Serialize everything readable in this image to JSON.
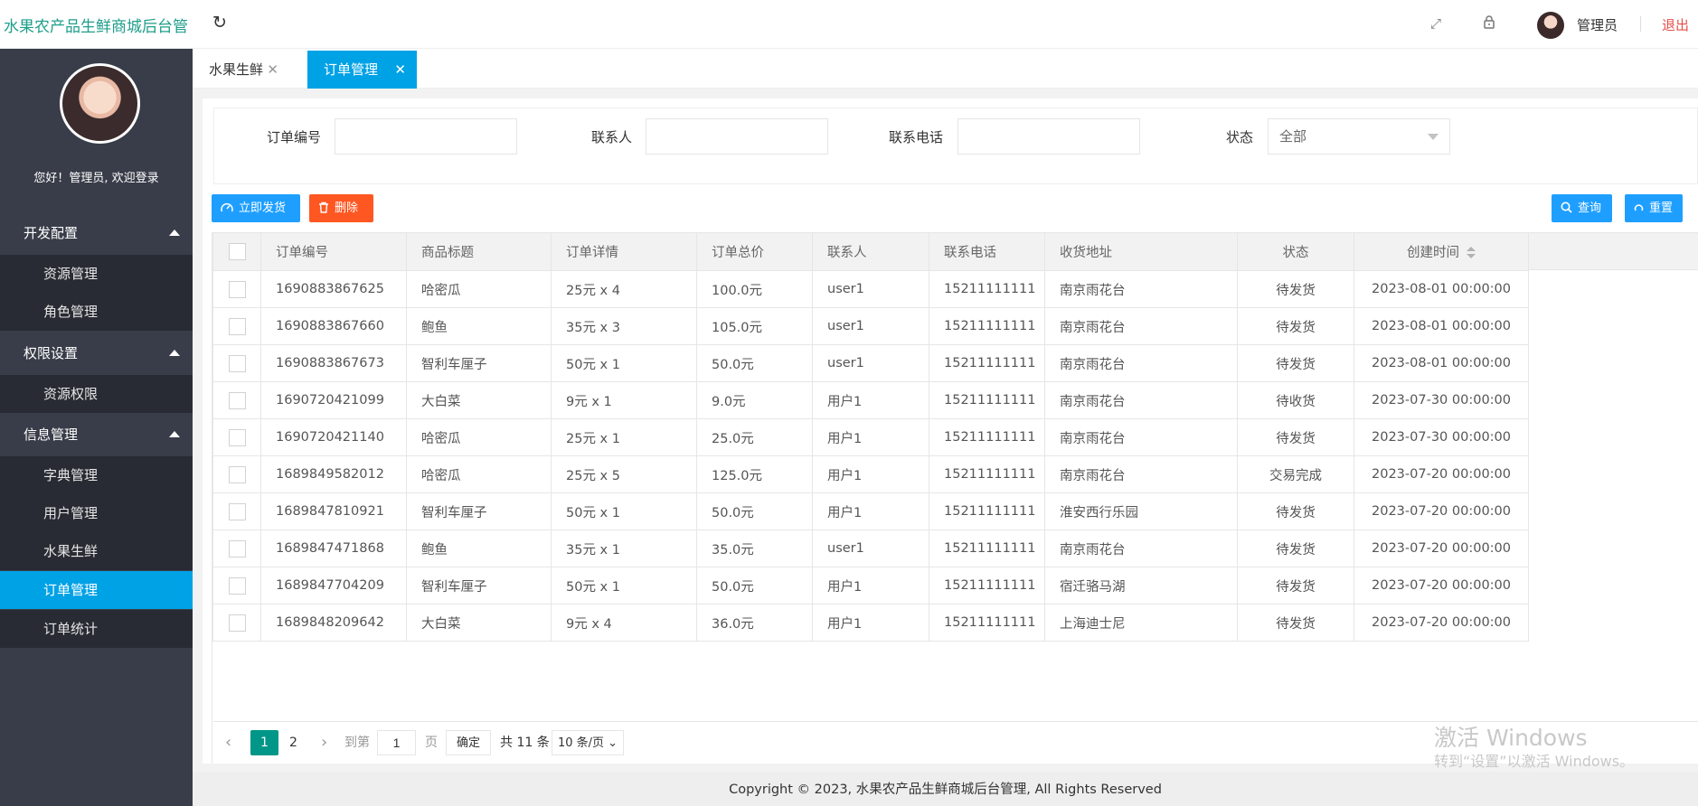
{
  "header": {
    "app_title": "水果农产品生鲜商城后台管",
    "admin_name": "管理员",
    "logout": "退出",
    "icons": [
      "refresh-icon",
      "fullscreen-icon",
      "lock-icon"
    ]
  },
  "sidebar": {
    "welcome": "您好！管理员, 欢迎登录",
    "groups": [
      {
        "label": "开发配置",
        "items": [
          "资源管理",
          "角色管理"
        ]
      },
      {
        "label": "权限设置",
        "items": [
          "资源权限"
        ]
      },
      {
        "label": "信息管理",
        "items": [
          "字典管理",
          "用户管理",
          "水果生鲜",
          "订单管理",
          "订单统计"
        ]
      }
    ],
    "active_item": "订单管理",
    "colors": {
      "bg": "#393d49",
      "submenu_bg": "#282b33",
      "active": "#00a2e6"
    }
  },
  "tabs": [
    {
      "label": "水果生鲜",
      "active": false
    },
    {
      "label": "订单管理",
      "active": true
    }
  ],
  "search": {
    "order_no_label": "订单编号",
    "contact_label": "联系人",
    "phone_label": "联系电话",
    "status_label": "状态",
    "status_value": "全部",
    "order_no_value": "",
    "contact_value": "",
    "phone_value": ""
  },
  "toolbar": {
    "ship_label": "立即发货",
    "delete_label": "删除",
    "query_label": "查询",
    "reset_label": "重置"
  },
  "table": {
    "columns": [
      "订单编号",
      "商品标题",
      "订单详情",
      "订单总价",
      "联系人",
      "联系电话",
      "收货地址",
      "状态",
      "创建时间"
    ],
    "rows": [
      [
        "1690883867625",
        "哈密瓜",
        "25元 x 4",
        "100.0元",
        "user1",
        "15211111111",
        "南京雨花台",
        "待发货",
        "2023-08-01 00:00:00"
      ],
      [
        "1690883867660",
        "鲍鱼",
        "35元 x 3",
        "105.0元",
        "user1",
        "15211111111",
        "南京雨花台",
        "待发货",
        "2023-08-01 00:00:00"
      ],
      [
        "1690883867673",
        "智利车厘子",
        "50元 x 1",
        "50.0元",
        "user1",
        "15211111111",
        "南京雨花台",
        "待发货",
        "2023-08-01 00:00:00"
      ],
      [
        "1690720421099",
        "大白菜",
        "9元 x 1",
        "9.0元",
        "用户1",
        "15211111111",
        "南京雨花台",
        "待收货",
        "2023-07-30 00:00:00"
      ],
      [
        "1690720421140",
        "哈密瓜",
        "25元 x 1",
        "25.0元",
        "用户1",
        "15211111111",
        "南京雨花台",
        "待发货",
        "2023-07-30 00:00:00"
      ],
      [
        "1689849582012",
        "哈密瓜",
        "25元 x 5",
        "125.0元",
        "用户1",
        "15211111111",
        "南京雨花台",
        "交易完成",
        "2023-07-20 00:00:00"
      ],
      [
        "1689847810921",
        "智利车厘子",
        "50元 x 1",
        "50.0元",
        "用户1",
        "15211111111",
        "淮安西行乐园",
        "待发货",
        "2023-07-20 00:00:00"
      ],
      [
        "1689847471868",
        "鲍鱼",
        "35元 x 1",
        "35.0元",
        "user1",
        "15211111111",
        "南京雨花台",
        "待发货",
        "2023-07-20 00:00:00"
      ],
      [
        "1689847704209",
        "智利车厘子",
        "50元 x 1",
        "50.0元",
        "用户1",
        "15211111111",
        "宿迁骆马湖",
        "待发货",
        "2023-07-20 00:00:00"
      ],
      [
        "1689848209642",
        "大白菜",
        "9元 x 4",
        "36.0元",
        "用户1",
        "15211111111",
        "上海迪士尼",
        "待发货",
        "2023-07-20 00:00:00"
      ]
    ]
  },
  "pager": {
    "current_page": "1",
    "page_2": "2",
    "goto_label": "到第",
    "goto_value": "1",
    "page_unit": "页",
    "confirm_label": "确定",
    "total_label": "共 11 条",
    "page_size": "10 条/页"
  },
  "footer": {
    "text": "Copyright © 2023, 水果农产品生鲜商城后台管理, All Rights Reserved"
  },
  "watermark": {
    "line1": "激活 Windows",
    "line2": "转到“设置”以激活 Windows。"
  }
}
